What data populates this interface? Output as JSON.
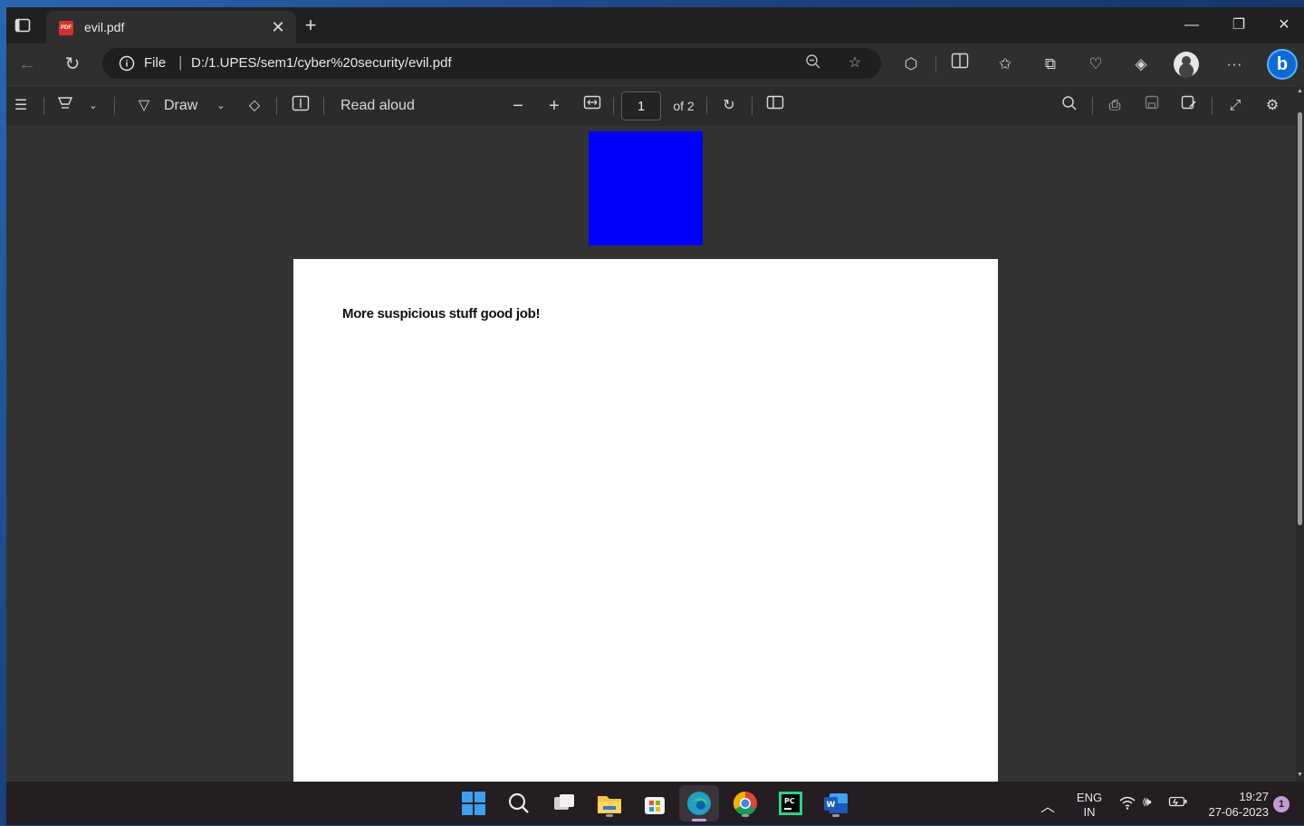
{
  "browser": {
    "tab_title": "evil.pdf",
    "favicon_text": "PDF",
    "address_scheme": "File",
    "address_url": "D:/1.UPES/sem1/cyber%20security/evil.pdf"
  },
  "pdf_toolbar": {
    "draw_label": "Draw",
    "read_aloud_label": "Read aloud",
    "page_number": "1",
    "page_total": "of 2"
  },
  "document": {
    "text_line": "More suspicious stuff good job!",
    "square_color": "#0000ff"
  },
  "taskbar": {
    "language": "ENG",
    "region": "IN",
    "time": "19:27",
    "date": "27-06-2023",
    "notification_count": "1"
  }
}
